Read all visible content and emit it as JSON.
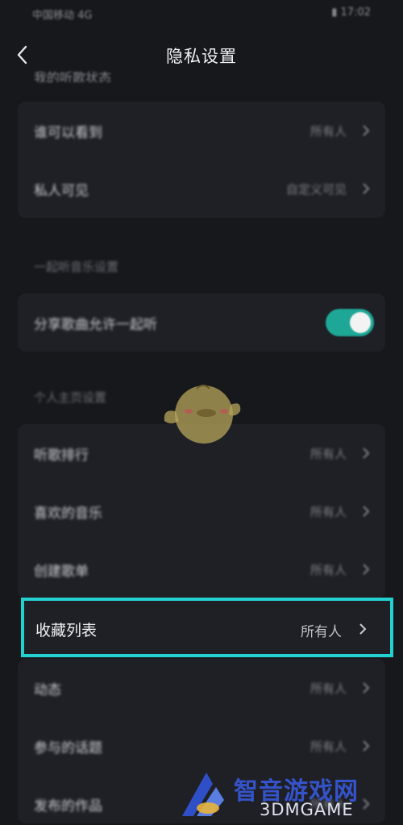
{
  "status_bar": {
    "carrier": "中国移动 4G",
    "right": "▮ 17:02"
  },
  "header": {
    "title": "隐私设置",
    "back_icon": "chevron-left-icon"
  },
  "sections": {
    "top_cut_title": "我的听歌状态",
    "group1": [
      {
        "label": "谁可以看到",
        "value": "所有人"
      },
      {
        "label": "私人可见",
        "value": "自定义可见"
      }
    ],
    "listen_together_title": "一起听音乐设置",
    "listen_together": {
      "label": "分享歌曲允许一起听",
      "toggle_on": true
    },
    "personal_title": "个人主页设置",
    "group3": [
      {
        "label": "听歌排行",
        "value": "所有人"
      },
      {
        "label": "喜欢的音乐",
        "value": "所有人"
      },
      {
        "label": "创建歌单",
        "value": "所有人"
      }
    ],
    "highlighted": {
      "label": "收藏列表",
      "value": "所有人"
    },
    "group4": [
      {
        "label": "动态",
        "value": "所有人"
      },
      {
        "label": "参与的话题",
        "value": "所有人"
      },
      {
        "label": "发布的作品",
        "value": "所有人"
      }
    ]
  },
  "watermark": {
    "cn": "智音游戏网",
    "en": "3DMGAME"
  },
  "colors": {
    "accent": "#23d1d0",
    "toggle": "#1ea796",
    "background": "#17181c",
    "card": "#1f2026"
  }
}
